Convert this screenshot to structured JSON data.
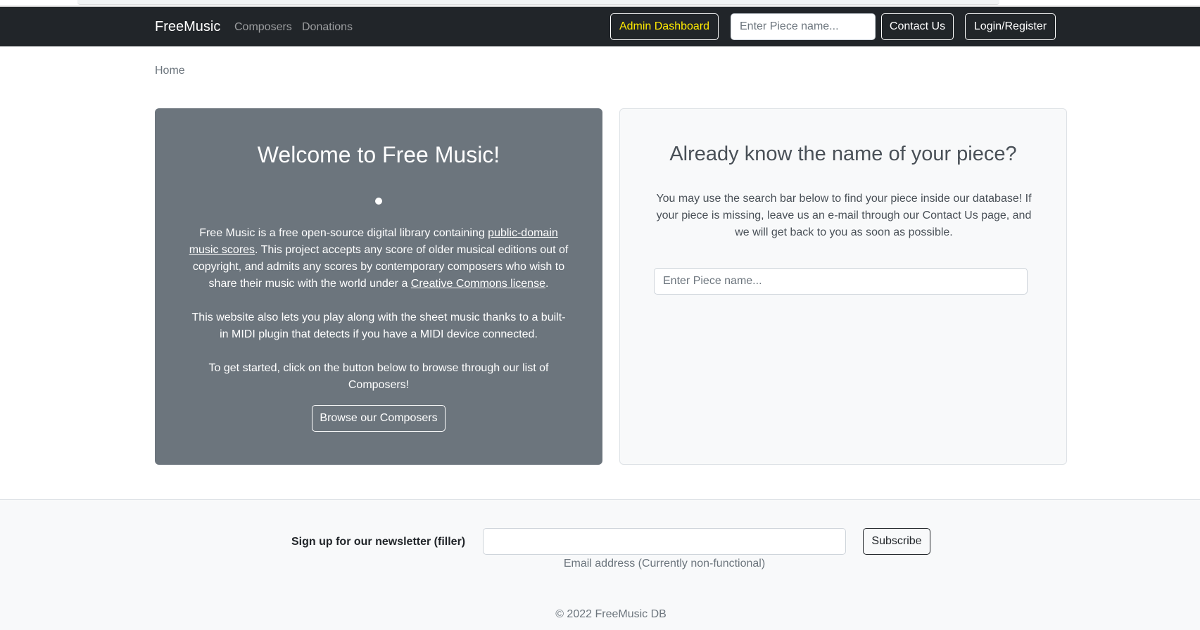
{
  "navbar": {
    "brand": "FreeMusic",
    "links": [
      "Composers",
      "Donations"
    ],
    "admin_label": "Admin Dashboard",
    "search_placeholder": "Enter Piece name...",
    "contact_label": "Contact Us",
    "login_label": "Login/Register"
  },
  "breadcrumb": "Home",
  "welcome": {
    "title": "Welcome to Free Music!",
    "p1_text_a": "Free Music is a free open-source digital library containing ",
    "p1_link_a": "public-domain music scores",
    "p1_text_b": ". This project accepts any score of older musical editions out of copyright, and admits any scores by contemporary composers who wish to share their music with the world under a ",
    "p1_link_b": "Creative Commons license",
    "p1_text_c": ".",
    "p2": "This website also lets you play along with the sheet music thanks to a built-in MIDI plugin that detects if you have a MIDI device connected.",
    "p3": "To get started, click on the button below to browse through our list of Composers!",
    "browse_label": "Browse our Composers"
  },
  "search_card": {
    "title": "Already know the name of your piece?",
    "description": "You may use the search bar below to find your piece inside our database! If your piece is missing, leave us an e-mail through our Contact Us page, and we will get back to you as soon as possible.",
    "placeholder": "Enter Piece name..."
  },
  "footer": {
    "newsletter_label": "Sign up for our newsletter (filler)",
    "email_help": "Email address (Currently non-functional)",
    "subscribe_label": "Subscribe",
    "copyright": "© 2022 FreeMusic DB"
  }
}
